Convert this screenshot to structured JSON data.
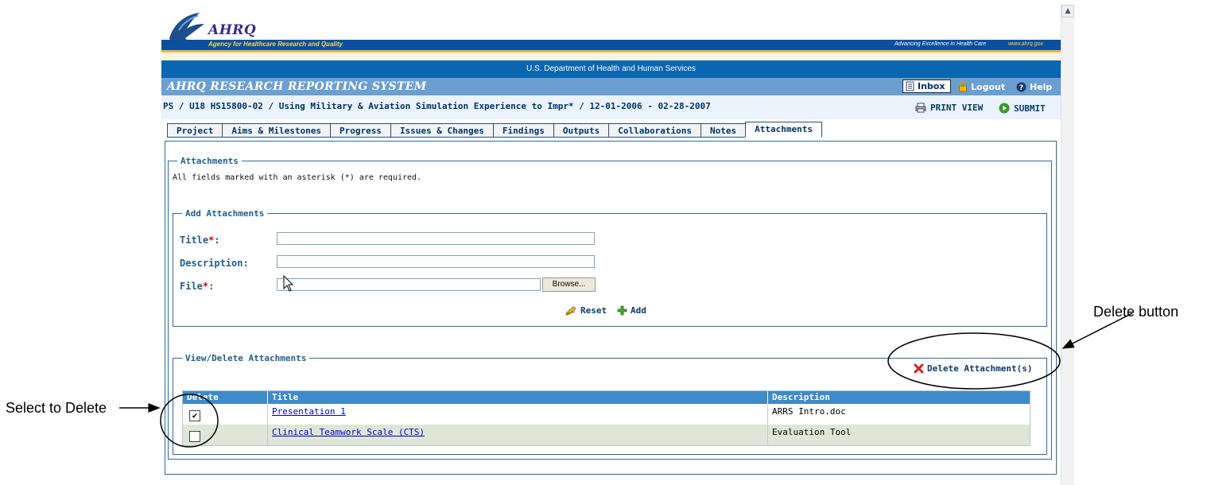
{
  "header": {
    "org_short": "AHRQ",
    "org_full": "Agency for Healthcare Research and Quality",
    "tagline": "Advancing Excellence in Health Care",
    "url": "www.ahrq.gov",
    "department": "U.S. Department of Health and Human Services",
    "system_title": "AHRQ RESEARCH REPORTING SYSTEM",
    "nav": {
      "inbox": "Inbox",
      "logout": "Logout",
      "help": "Help"
    }
  },
  "project": {
    "line": "PS / U18 HS15800-02 / Using Military & Aviation Simulation Experience to Impr* / 12-01-2006 - 02-28-2007",
    "print_view": "PRINT VIEW",
    "submit": "SUBMIT"
  },
  "tabs": [
    {
      "label": "Project"
    },
    {
      "label": "Aims & Milestones"
    },
    {
      "label": "Progress"
    },
    {
      "label": "Issues & Changes"
    },
    {
      "label": "Findings"
    },
    {
      "label": "Outputs"
    },
    {
      "label": "Collaborations"
    },
    {
      "label": "Notes"
    },
    {
      "label": "Attachments",
      "active": true
    }
  ],
  "attachments": {
    "legend": "Attachments",
    "required_note": "All fields marked with an asterisk (*) are required.",
    "add": {
      "legend": "Add Attachments",
      "title_label": "Title",
      "description_label": "Description:",
      "file_label": "File",
      "required_mark": "*",
      "colon": ":",
      "title_value": "",
      "description_value": "",
      "file_value": "",
      "browse": "Browse...",
      "reset": "Reset",
      "add": "Add"
    },
    "view": {
      "legend": "View/Delete Attachments",
      "delete_button": "Delete Attachment(s)",
      "columns": [
        "Delete",
        "Title",
        "Description"
      ],
      "rows": [
        {
          "checked": true,
          "title": "Presentation 1",
          "description": "ARRS Intro.doc"
        },
        {
          "checked": false,
          "title": "Clinical Teamwork Scale (CTS)",
          "description": "Evaluation Tool"
        }
      ]
    }
  },
  "annotations": {
    "delete_button_note": "Delete button",
    "select_note": "Select to Delete"
  },
  "colors": {
    "header_blue": "#0b66b0",
    "bar_blue": "#6a9fd0",
    "label_blue": "#1f5f8e",
    "table_header": "#3f8ac8",
    "row_alt": "#dfe6d7",
    "required_red": "#d4001a"
  },
  "icons": {
    "inbox": "document-icon",
    "logout": "padlock-icon",
    "help": "question-icon",
    "print": "printer-icon",
    "submit": "play-circle-icon",
    "reset": "pen-icon",
    "add": "plus-icon",
    "delete": "red-x-icon"
  }
}
